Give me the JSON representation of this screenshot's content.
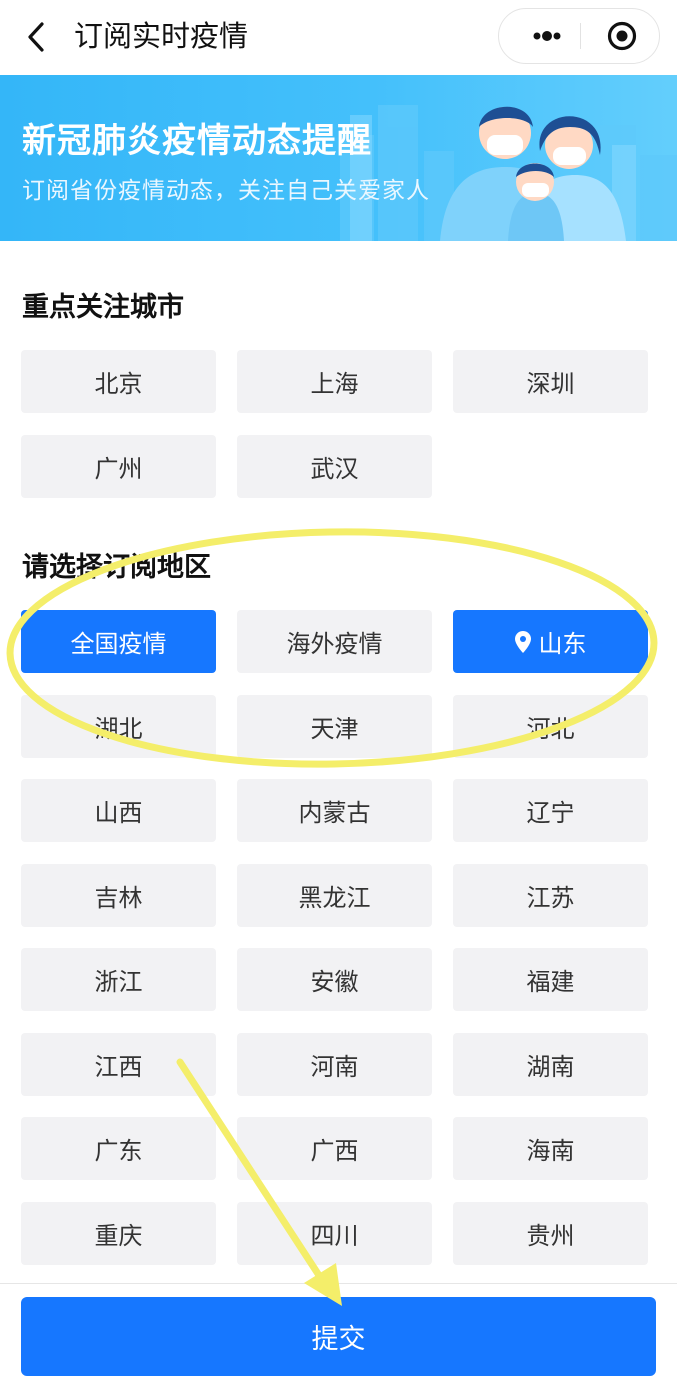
{
  "nav": {
    "title": "订阅实时疫情"
  },
  "banner": {
    "title": "新冠肺炎疫情动态提醒",
    "subtitle": "订阅省份疫情动态，关注自己关爱家人"
  },
  "focus": {
    "title": "重点关注城市",
    "items": [
      "北京",
      "上海",
      "深圳",
      "广州",
      "武汉"
    ]
  },
  "regions": {
    "title": "请选择订阅地区",
    "items": [
      {
        "label": "全国疫情",
        "selected": true
      },
      {
        "label": "海外疫情",
        "selected": false
      },
      {
        "label": "山东",
        "selected": true,
        "icon": "location-pin-icon"
      },
      {
        "label": "湖北",
        "selected": false
      },
      {
        "label": "天津",
        "selected": false
      },
      {
        "label": "河北",
        "selected": false
      },
      {
        "label": "山西",
        "selected": false
      },
      {
        "label": "内蒙古",
        "selected": false
      },
      {
        "label": "辽宁",
        "selected": false
      },
      {
        "label": "吉林",
        "selected": false
      },
      {
        "label": "黑龙江",
        "selected": false
      },
      {
        "label": "江苏",
        "selected": false
      },
      {
        "label": "浙江",
        "selected": false
      },
      {
        "label": "安徽",
        "selected": false
      },
      {
        "label": "福建",
        "selected": false
      },
      {
        "label": "江西",
        "selected": false
      },
      {
        "label": "河南",
        "selected": false
      },
      {
        "label": "湖南",
        "selected": false
      },
      {
        "label": "广东",
        "selected": false
      },
      {
        "label": "广西",
        "selected": false
      },
      {
        "label": "海南",
        "selected": false
      },
      {
        "label": "重庆",
        "selected": false
      },
      {
        "label": "四川",
        "selected": false
      },
      {
        "label": "贵州",
        "selected": false
      }
    ]
  },
  "submit": {
    "label": "提交"
  },
  "colors": {
    "primary": "#1677ff",
    "banner": "#3db9f9",
    "annotation": "#f4ee6a"
  }
}
